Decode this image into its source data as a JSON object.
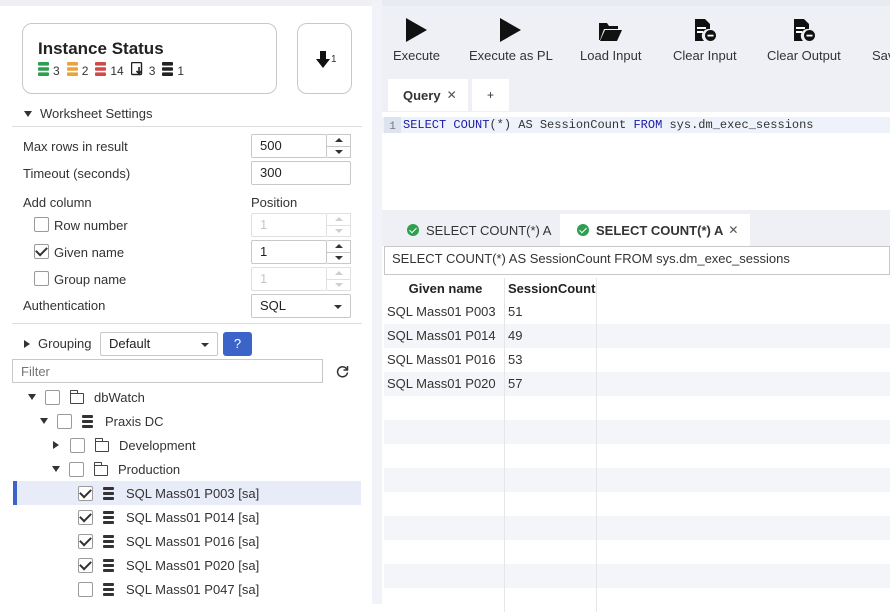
{
  "instance_status": {
    "title": "Instance Status",
    "counts": [
      {
        "icon": "green-database-icon",
        "color": "#2e9e4f",
        "value": "3"
      },
      {
        "icon": "orange-database-icon",
        "color": "#e8a33d",
        "value": "2"
      },
      {
        "icon": "red-database-icon",
        "color": "#d04a4a",
        "value": "14"
      },
      {
        "icon": "import-database-icon",
        "color": "#222222",
        "value": "3"
      },
      {
        "icon": "black-database-icon",
        "color": "#222222",
        "value": "1"
      }
    ],
    "export_count": "1"
  },
  "worksheet_settings": {
    "title": "Worksheet Settings",
    "max_rows_label": "Max rows in result",
    "max_rows_value": "500",
    "timeout_label": "Timeout (seconds)",
    "timeout_value": "300",
    "add_column_label": "Add column",
    "position_label": "Position",
    "columns": [
      {
        "label": "Row number",
        "checked": false,
        "position": "1",
        "enabled": false
      },
      {
        "label": "Given name",
        "checked": true,
        "position": "1",
        "enabled": true
      },
      {
        "label": "Group name",
        "checked": false,
        "position": "1",
        "enabled": false
      }
    ],
    "authentication_label": "Authentication",
    "authentication_value": "SQL"
  },
  "grouping": {
    "label": "Grouping",
    "value": "Default",
    "help_label": "?"
  },
  "filter": {
    "placeholder": "Filter"
  },
  "tree": [
    {
      "label": "dbWatch",
      "type": "folder",
      "indent": 0,
      "expander": "down",
      "checked": false
    },
    {
      "label": "Praxis DC",
      "type": "server",
      "indent": 1,
      "expander": "down",
      "checked": false
    },
    {
      "label": "Development",
      "type": "folder",
      "indent": 2,
      "expander": "right",
      "checked": false
    },
    {
      "label": "Production",
      "type": "folder",
      "indent": 2,
      "expander": "down",
      "checked": false
    },
    {
      "label": "SQL Mass01 P003 [sa]",
      "type": "database",
      "indent": 3,
      "expander": "none",
      "checked": true,
      "selected": true
    },
    {
      "label": "SQL Mass01 P014 [sa]",
      "type": "database",
      "indent": 3,
      "expander": "none",
      "checked": true
    },
    {
      "label": "SQL Mass01 P016 [sa]",
      "type": "database",
      "indent": 3,
      "expander": "none",
      "checked": true
    },
    {
      "label": "SQL Mass01 P020 [sa]",
      "type": "database",
      "indent": 3,
      "expander": "none",
      "checked": true
    },
    {
      "label": "SQL Mass01 P047 [sa]",
      "type": "database",
      "indent": 3,
      "expander": "none",
      "checked": false
    }
  ],
  "toolbar": {
    "execute": "Execute",
    "execute_pl": "Execute as PL",
    "load_input": "Load Input",
    "clear_input": "Clear Input",
    "clear_output": "Clear Output",
    "save": "Sav"
  },
  "query_tabs": {
    "active": "Query",
    "close": "✕",
    "add": "+"
  },
  "editor": {
    "line_number": "1",
    "tokens": [
      {
        "text": "SELECT",
        "kw": true
      },
      {
        "text": " ",
        "kw": false
      },
      {
        "text": "COUNT",
        "kw": true
      },
      {
        "text": "(*) AS SessionCount ",
        "kw": false
      },
      {
        "text": "FROM",
        "kw": true
      },
      {
        "text": " sys.dm_exec_sessions",
        "kw": false
      }
    ]
  },
  "result_tabs": [
    {
      "label": "SELECT COUNT(*) A",
      "active": false
    },
    {
      "label": "SELECT COUNT(*) A",
      "active": true,
      "close": "✕"
    }
  ],
  "result": {
    "sql_text": "SELECT COUNT(*) AS SessionCount FROM sys.dm_exec_sessions",
    "columns": [
      "Given name",
      "SessionCount"
    ],
    "rows": [
      [
        "SQL Mass01 P003",
        "51"
      ],
      [
        "SQL Mass01 P014",
        "49"
      ],
      [
        "SQL Mass01 P016",
        "53"
      ],
      [
        "SQL Mass01 P020",
        "57"
      ]
    ],
    "empty_rows": 9
  }
}
